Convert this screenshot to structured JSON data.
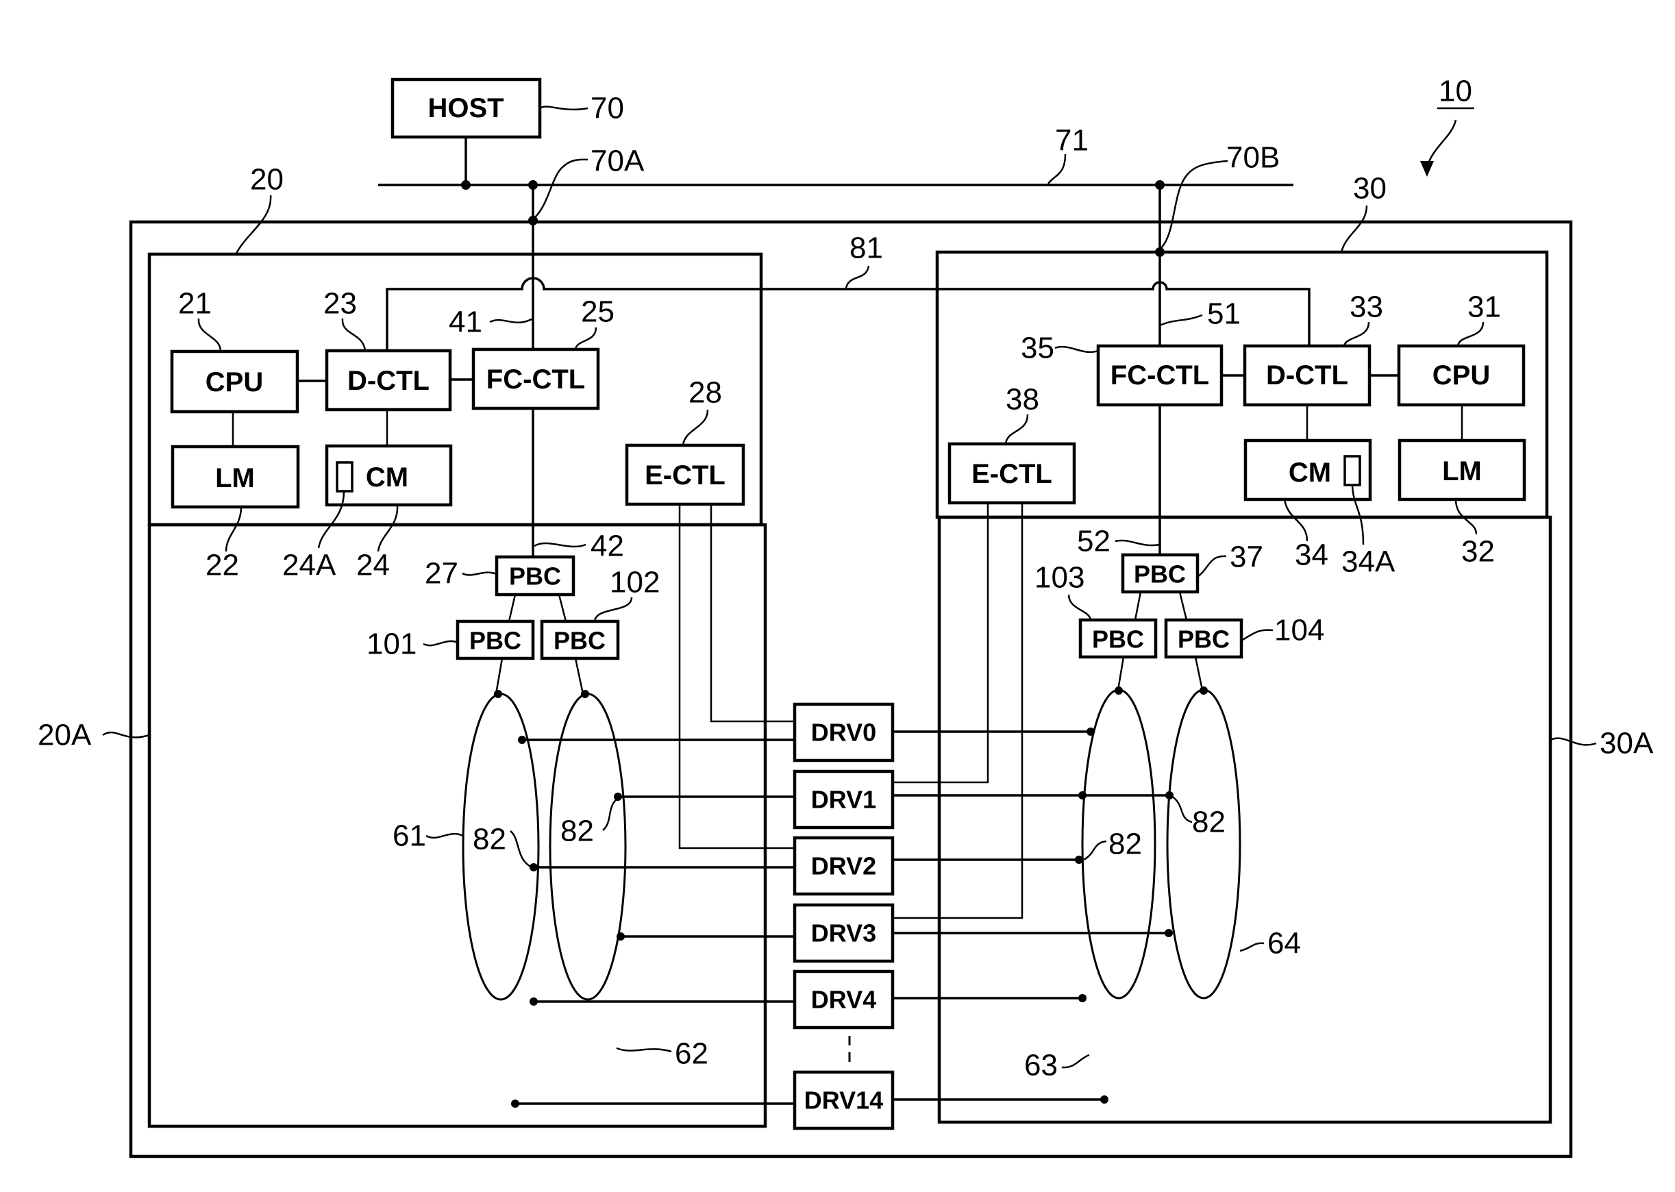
{
  "figure": {
    "system_ref": "10",
    "host": {
      "label": "HOST",
      "ref": "70"
    },
    "network": {
      "ref": "71",
      "port_a_ref": "70A",
      "port_b_ref": "70B"
    },
    "inter_controller_link_ref": "81",
    "controllers": [
      {
        "ref": "20",
        "enclosure_ref": "20A",
        "blocks": {
          "cpu": {
            "label": "CPU",
            "ref": "21"
          },
          "lm": {
            "label": "LM",
            "ref": "22"
          },
          "dctl": {
            "label": "D-CTL",
            "ref": "23"
          },
          "cm": {
            "label": "CM",
            "ref": "24",
            "sub_ref": "24A"
          },
          "fcctl": {
            "label": "FC-CTL",
            "ref": "25"
          },
          "ectl": {
            "label": "E-CTL",
            "ref": "28"
          },
          "pbc_main": {
            "label": "PBC",
            "ref": "27"
          },
          "pbc_a": {
            "label": "PBC",
            "ref": "101"
          },
          "pbc_b": {
            "label": "PBC",
            "ref": "102"
          }
        },
        "path_upper_ref": "41",
        "path_lower_ref": "42",
        "loops": [
          "61",
          "62"
        ],
        "junction_ref": "82"
      },
      {
        "ref": "30",
        "enclosure_ref": "30A",
        "blocks": {
          "cpu": {
            "label": "CPU",
            "ref": "31"
          },
          "lm": {
            "label": "LM",
            "ref": "32"
          },
          "dctl": {
            "label": "D-CTL",
            "ref": "33"
          },
          "cm": {
            "label": "CM",
            "ref": "34",
            "sub_ref": "34A"
          },
          "fcctl": {
            "label": "FC-CTL",
            "ref": "35"
          },
          "ectl": {
            "label": "E-CTL",
            "ref": "38"
          },
          "pbc_main": {
            "label": "PBC",
            "ref": "37"
          },
          "pbc_a": {
            "label": "PBC",
            "ref": "103"
          },
          "pbc_b": {
            "label": "PBC",
            "ref": "104"
          }
        },
        "path_upper_ref": "51",
        "path_lower_ref": "52",
        "loops": [
          "63",
          "64"
        ],
        "junction_ref": "82"
      }
    ],
    "drives": [
      "DRV0",
      "DRV1",
      "DRV2",
      "DRV3",
      "DRV4",
      "DRV14"
    ]
  }
}
